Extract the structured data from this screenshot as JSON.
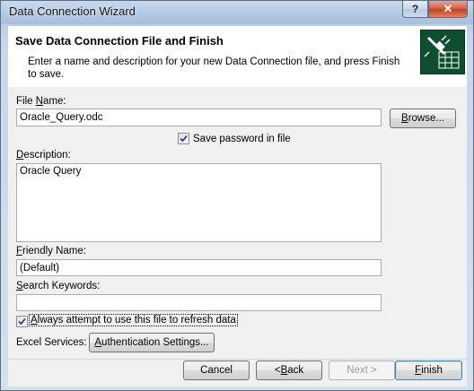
{
  "window": {
    "title": "Data Connection Wizard",
    "help_glyph": "?",
    "close_glyph": "✕"
  },
  "header": {
    "title": "Save Data Connection File and Finish",
    "description": "Enter a name and description for your new Data Connection file, and press Finish to save."
  },
  "form": {
    "file_name": {
      "label_pre": "File ",
      "label_key": "N",
      "label_post": "ame:",
      "value": "Oracle_Query.odc"
    },
    "browse_button": {
      "pre": "",
      "key": "B",
      "post": "rowse..."
    },
    "save_password": {
      "label": "Save password in file",
      "checked": true
    },
    "description": {
      "label_pre": "",
      "label_key": "D",
      "label_post": "escription:",
      "value": "Oracle Query"
    },
    "friendly_name": {
      "label_pre": "",
      "label_key": "F",
      "label_post": "riendly Name:",
      "value": "(Default)"
    },
    "search_keywords": {
      "label_pre": "",
      "label_key": "S",
      "label_post": "earch Keywords:",
      "value": ""
    },
    "always_refresh": {
      "label_pre": "",
      "label_key": "A",
      "label_post": "lways attempt to use this file to refresh data",
      "checked": true
    },
    "excel_services_label": "Excel Services:",
    "auth_button": {
      "pre": "",
      "key": "A",
      "post": "uthentication Settings..."
    }
  },
  "footer": {
    "cancel": "Cancel",
    "back": {
      "pre": "< ",
      "key": "B",
      "post": "ack"
    },
    "next": "Next >",
    "finish": {
      "pre": "",
      "key": "F",
      "post": "inish"
    }
  },
  "colors": {
    "icon_bg": "#0e4d2e",
    "title_gradient": "#b1c7e2",
    "close_red": "#c4411f"
  },
  "icons": {
    "header_icon": "data-connection-wizard-icon",
    "check": "checkmark-icon"
  }
}
